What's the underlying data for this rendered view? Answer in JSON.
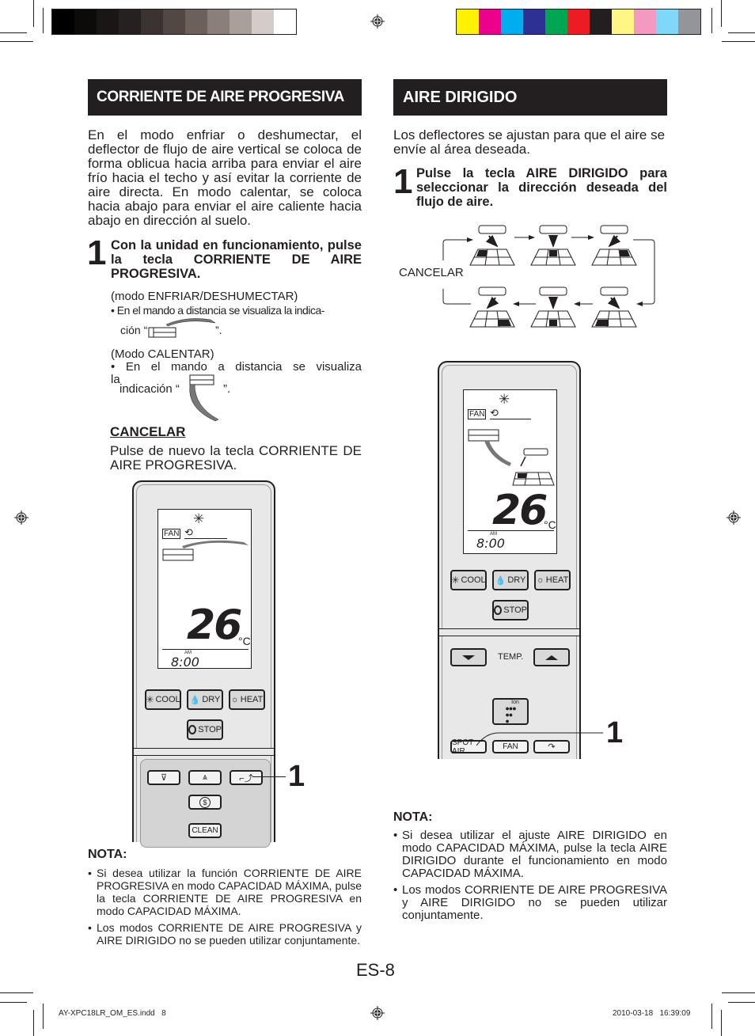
{
  "print_marks": {
    "grayscale_swatches": [
      "#000000",
      "#0d0b0a",
      "#1a1615",
      "#262120",
      "#3b3331",
      "#514744",
      "#6c605b",
      "#8a7f79",
      "#aaa09b",
      "#d4ccc9",
      "#ffffff"
    ],
    "color_swatches": [
      "#fff200",
      "#ec008c",
      "#00aeef",
      "#2e3192",
      "#00a651",
      "#ed1c24",
      "#231f20",
      "#fff685",
      "#f49ac1",
      "#7fd8f7",
      "#939598"
    ]
  },
  "left": {
    "header": "CORRIENTE DE AIRE PROGRESIVA",
    "intro": "En el modo enfriar o deshumectar, el deflector de flujo de aire vertical se coloca de forma oblicua hacia arriba para enviar el aire frío hacia el techo y así evitar la corriente de aire directa. En modo calentar, se coloca hacia abajo para enviar el aire caliente hacia abajo en dirección al suelo.",
    "step_number": "1",
    "step_text": "Con la unidad en funcionamiento, pulse la tecla CORRIENTE DE AIRE PROGRESIVA.",
    "cool_mode_label": "(modo ENFRIAR/DESHUMECTAR)",
    "cool_mode_bullet_a": "En el mando a distancia se visualiza la indica-",
    "cool_mode_bullet_b": "ción “",
    "cool_mode_bullet_c": "”.",
    "heat_mode_label": "(Modo CALENTAR)",
    "heat_mode_bullet_a": "En el mando a distancia se visualiza la",
    "heat_mode_bullet_b": "indicación “",
    "heat_mode_bullet_c": "”.",
    "cancel_title": "CANCELAR",
    "cancel_text": "Pulse de nuevo la tecla CORRIENTE DE AIRE PROGRESIVA.",
    "remote": {
      "fan_label": "FAN",
      "temperature": "26",
      "temp_unit": "°C",
      "am_label": "AM",
      "time": "8:00",
      "buttons": {
        "cool": "COOL",
        "dry": "DRY",
        "heat": "HEAT",
        "stop": "STOP",
        "clean": "CLEAN"
      },
      "callout": "1"
    },
    "note_title": "NOTA:",
    "notes": [
      "Si desea utilizar la función CORRIENTE DE AIRE PROGRESIVA en modo CAPACIDAD MÁXIMA, pulse la tecla CORRIENTE DE AIRE PROGRESIVA en modo CAPACIDAD MÁXIMA.",
      "Los modos CORRIENTE DE AIRE PROGRESIVA y AIRE DIRIGIDO no se pueden utilizar conjuntamente."
    ]
  },
  "right": {
    "header": "AIRE DIRIGIDO",
    "intro": "Los deflectores se ajustan para que el aire se envíe al área deseada.",
    "step_number": "1",
    "step_text": "Pulse la tecla AIRE DIRIGIDO para seleccionar la dirección deseada del flujo de aire.",
    "cycle_cancel_label": "CANCELAR",
    "cycle_positions": [
      "left-near",
      "center-near",
      "right-near",
      "left-far",
      "center-far",
      "right-far"
    ],
    "remote": {
      "fan_label": "FAN",
      "temperature": "26",
      "temp_unit": "°C",
      "am_label": "AM",
      "time": "8:00",
      "buttons": {
        "cool": "COOL",
        "dry": "DRY",
        "heat": "HEAT",
        "stop": "STOP",
        "temp": "TEMP.",
        "ion": "Ion",
        "spot_air": "SPOT AIR",
        "fan": "FAN"
      },
      "callout": "1"
    },
    "note_title": "NOTA:",
    "notes": [
      "Si desea utilizar el ajuste AIRE DIRIGIDO en modo CAPACIDAD MÁXIMA, pulse la tecla AIRE DIRIGIDO durante el funcionamiento en modo CAPACIDAD MÁXIMA.",
      "Los modos CORRIENTE DE AIRE PROGRESIVA y AIRE DIRIGIDO no se pueden utilizar conjuntamente."
    ]
  },
  "footer": {
    "page_number": "ES-8",
    "file_name": "AY-XPC18LR_OM_ES.indd   8",
    "timestamp": "2010-03-18   16:39:09"
  }
}
